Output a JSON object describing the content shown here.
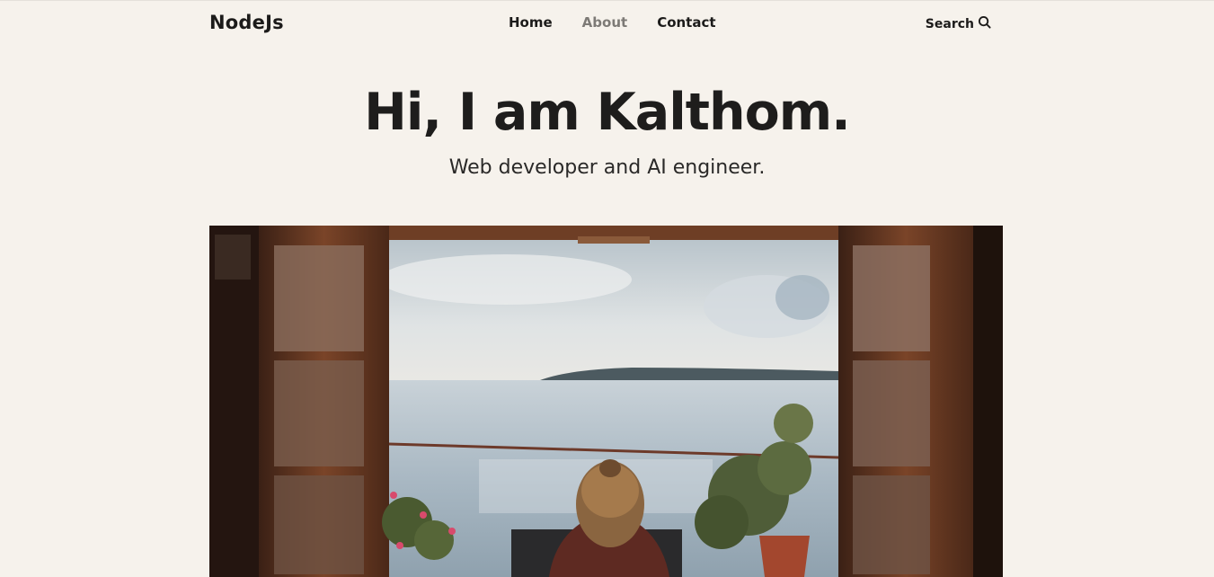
{
  "header": {
    "logo": "NodeJs",
    "nav": [
      {
        "label": "Home",
        "current": false
      },
      {
        "label": "About",
        "current": true
      },
      {
        "label": "Contact",
        "current": false
      }
    ],
    "search_label": "Search"
  },
  "hero": {
    "title": "Hi, I am Kalthom.",
    "subtitle": "Web developer and AI engineer.",
    "image_icon": "photo-woman-at-window-sea-view"
  },
  "colors": {
    "background": "#f6f2ec",
    "text": "#1c1b1a",
    "nav_current": "#7d7a76"
  }
}
